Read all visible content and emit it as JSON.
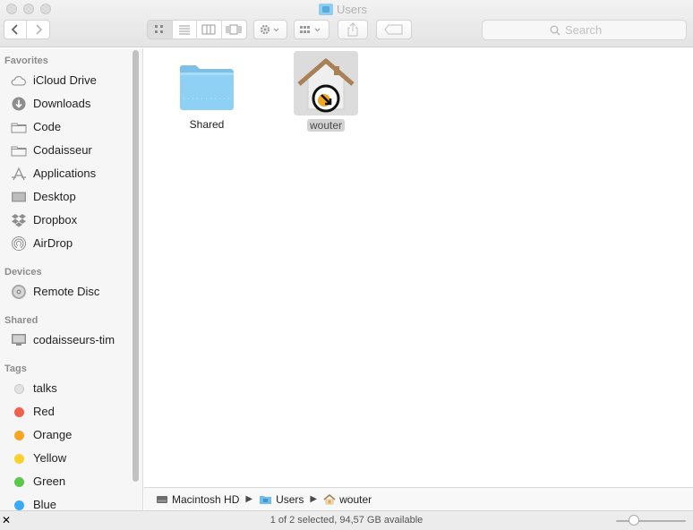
{
  "window": {
    "title": "Users"
  },
  "toolbar": {
    "back_icon": "chevron-left-icon",
    "forward_icon": "chevron-right-icon",
    "view_modes": [
      "icon-view",
      "list-view",
      "column-view",
      "cover-flow-view"
    ],
    "active_view": "icon-view",
    "search_placeholder": "Search"
  },
  "sidebar": {
    "sections": {
      "favorites": "Favorites",
      "devices": "Devices",
      "shared": "Shared",
      "tags": "Tags"
    },
    "favorites": [
      {
        "label": "iCloud Drive",
        "icon": "cloud-icon"
      },
      {
        "label": "Downloads",
        "icon": "download-icon"
      },
      {
        "label": "Code",
        "icon": "folder-icon"
      },
      {
        "label": "Codaisseur",
        "icon": "folder-icon"
      },
      {
        "label": "Applications",
        "icon": "applications-icon"
      },
      {
        "label": "Desktop",
        "icon": "desktop-icon"
      },
      {
        "label": "Dropbox",
        "icon": "dropbox-icon"
      },
      {
        "label": "AirDrop",
        "icon": "airdrop-icon"
      }
    ],
    "devices": [
      {
        "label": "Remote Disc",
        "icon": "disc-icon"
      }
    ],
    "shared": [
      {
        "label": "codaisseurs-tim",
        "icon": "computer-icon"
      }
    ],
    "tags": [
      {
        "label": "talks",
        "color": "#e2e2e2"
      },
      {
        "label": "Red",
        "color": "#f0604f"
      },
      {
        "label": "Orange",
        "color": "#f5a623"
      },
      {
        "label": "Yellow",
        "color": "#f8d12c"
      },
      {
        "label": "Green",
        "color": "#5cc84b"
      },
      {
        "label": "Blue",
        "color": "#3aaaf5"
      }
    ]
  },
  "content": {
    "items": [
      {
        "name": "Shared",
        "icon": "shared-folder-icon",
        "selected": false
      },
      {
        "name": "wouter",
        "icon": "home-folder-icon",
        "selected": true
      }
    ]
  },
  "pathbar": {
    "segments": [
      {
        "label": "Macintosh HD",
        "icon": "hard-drive-icon"
      },
      {
        "label": "Users",
        "icon": "folder-icon"
      },
      {
        "label": "wouter",
        "icon": "home-icon"
      }
    ]
  },
  "status": {
    "text": "1 of 2 selected, 94,57 GB available"
  }
}
